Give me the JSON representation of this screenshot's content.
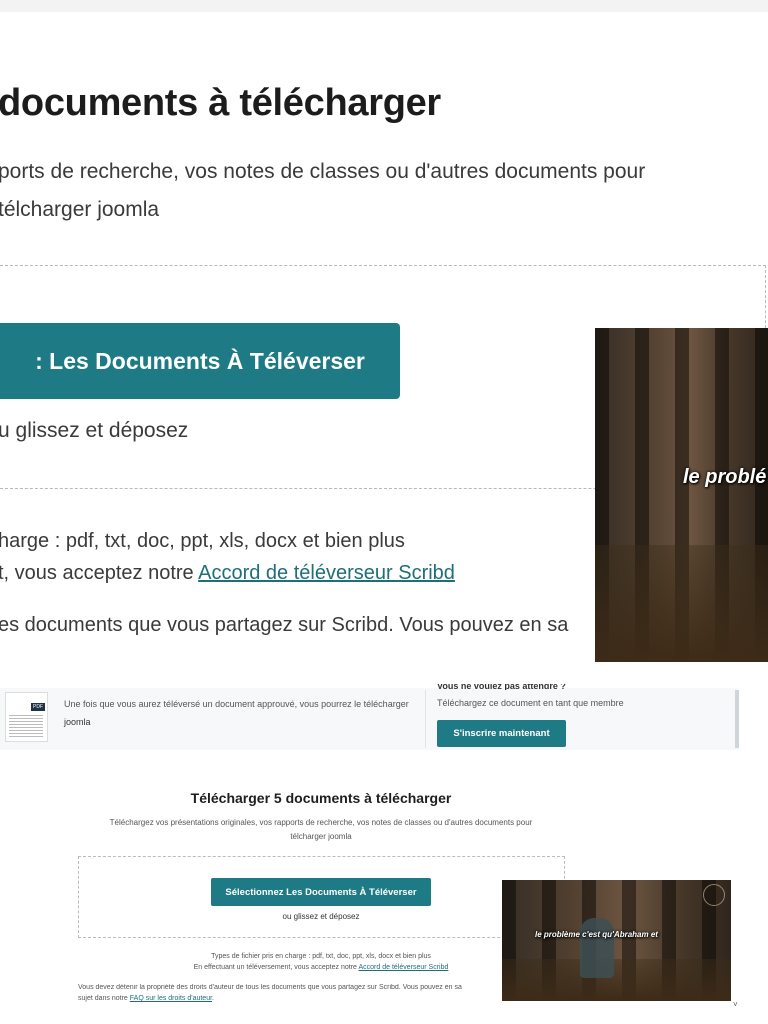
{
  "top": {
    "title": "documents à télécharger",
    "subtitle_line1": "ports de recherche, vos notes de classes ou d'autres documents pour",
    "subtitle_line2": "télcharger joomla",
    "select_button": ": Les Documents À Téléverser",
    "drag_text": "u glissez et déposez",
    "types_line": "harge : pdf, txt, doc, ppt, xls, docx et bien plus",
    "agree_prefix": "t, vous acceptez notre ",
    "agree_link": "Accord de téléverseur Scribd",
    "copyright_line": "es documents que vous partagez sur Scribd. Vous pouvez en sa",
    "video_caption": "le problé"
  },
  "card": {
    "message_line1": "Une fois que vous aurez téléversé un document approuvé, vous pourrez le télécharger",
    "message_line2": "joomla",
    "thumb_badge": "PDF",
    "right_heading": "Vous ne voulez pas attendre ?",
    "right_text": "Téléchargez ce document en tant que membre",
    "signup_button": "S'inscrire maintenant"
  },
  "bottom": {
    "title": "Télécharger 5 documents à télécharger",
    "subtitle_line1": "Téléchargez vos présentations originales, vos rapports de recherche, vos notes de classes ou d'autres documents pour",
    "subtitle_line2": "télcharger joomla",
    "select_button": "Sélectionnez Les Documents À Téléverser",
    "drag_text": "ou glissez et déposez",
    "types_line": "Types de fichier pris en charge : pdf, txt, doc, ppt, xls, docx et bien plus",
    "agree_prefix": "En effectuant un téléversement, vous acceptez notre ",
    "agree_link": "Accord de téléverseur Scribd",
    "copyright_line1": "Vous devez détenir la propriété des droits d'auteur de tous les documents que vous partagez sur Scribd. Vous pouvez en sa",
    "copyright_prefix2": "sujet dans notre ",
    "copyright_link": "FAQ sur les droits d'auteur",
    "copyright_suffix": ".",
    "video_caption": "le problème c'est qu'Abraham et"
  },
  "colors": {
    "teal": "#1e7b85",
    "link": "#1e6f78"
  }
}
